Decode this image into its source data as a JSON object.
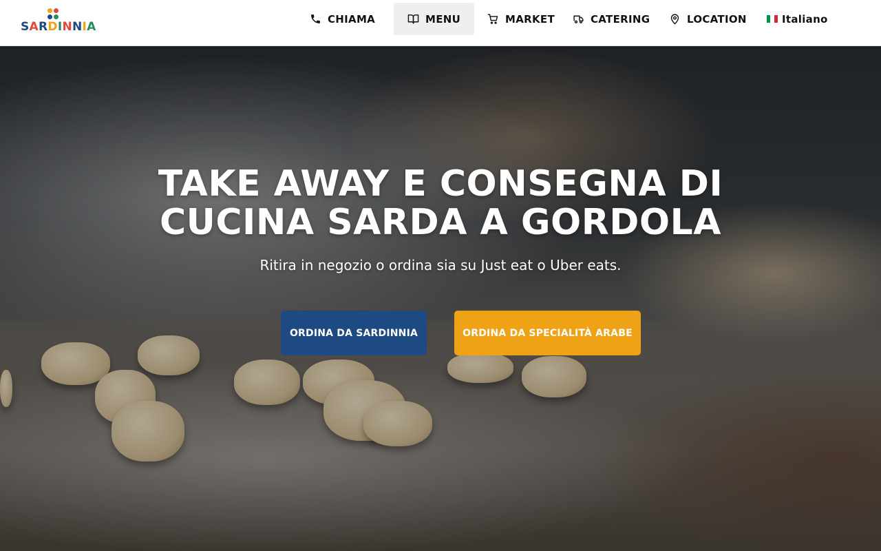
{
  "brand": {
    "name": "SARDINNIA",
    "letter_colors": [
      "#1d4a82",
      "#e0493a",
      "#1d4a82",
      "#f0a216",
      "#2a8a5a",
      "#e0493a",
      "#1d4a82",
      "#f0a216",
      "#2a8a5a"
    ],
    "dot_colors": [
      "#f0a216",
      "#e0493a",
      "#1d4a82",
      "#2a8a5a"
    ]
  },
  "nav": {
    "call": {
      "label": "CHIAMA",
      "icon": "phone-icon"
    },
    "menu": {
      "label": "MENU",
      "icon": "book-open-icon"
    },
    "market": {
      "label": "MARKET",
      "icon": "shopping-cart-icon"
    },
    "catering": {
      "label": "CATERING",
      "icon": "truck-icon"
    },
    "location": {
      "label": "LOCATION",
      "icon": "map-pin-icon"
    },
    "language": {
      "label": "Italiano",
      "flag_colors": [
        "#009246",
        "#ffffff",
        "#ce2b37"
      ]
    }
  },
  "hero": {
    "title_line1": "TAKE AWAY E CONSEGNA DI",
    "title_line2": "CUCINA SARDA A GORDOLA",
    "subtitle": "Ritira in negozio o ordina sia su Just eat o Uber eats.",
    "primary_button": "ORDINA DA SARDINNIA",
    "secondary_button": "ORDINA DA SPECIALITÀ ARABE"
  },
  "colors": {
    "primary": "#1d4a82",
    "accent": "#f0a216",
    "nav_active_bg": "#efefef"
  }
}
